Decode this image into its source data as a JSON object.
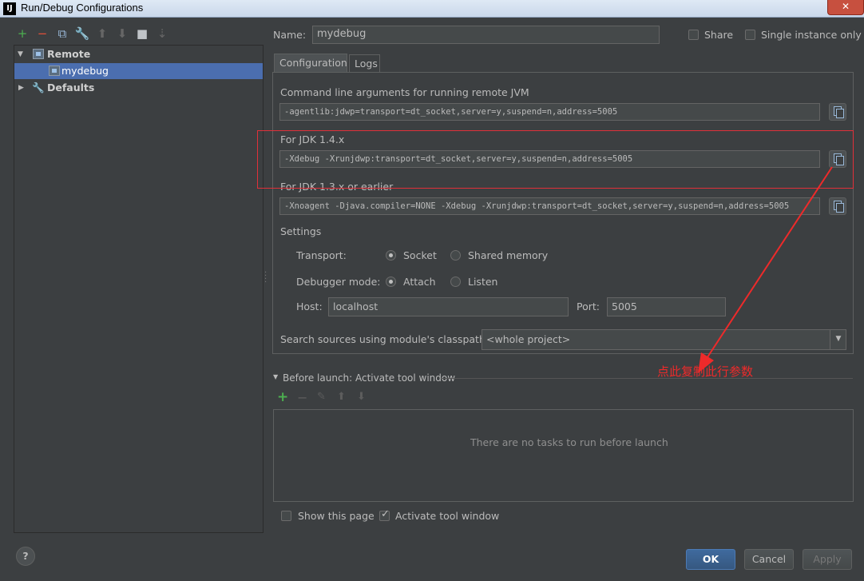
{
  "window": {
    "icon_text": "IJ",
    "title": "Run/Debug Configurations",
    "close_symbol": "✕"
  },
  "left_toolbar": {
    "icons": [
      {
        "name": "add-icon",
        "glyph": "+",
        "color": "#4caf50"
      },
      {
        "name": "remove-icon",
        "glyph": "−",
        "color": "#e0503a"
      },
      {
        "name": "copy-config-icon",
        "glyph": "⧉",
        "color": "#9ab9d9"
      },
      {
        "name": "edit-defaults-icon",
        "glyph": "🔧",
        "color": "#d7a84a"
      },
      {
        "name": "move-up-icon",
        "glyph": "⬆",
        "color": "#666666"
      },
      {
        "name": "move-down-icon",
        "glyph": "⬇",
        "color": "#666666"
      },
      {
        "name": "folder-icon",
        "glyph": "■",
        "color": "#c0c4c8"
      },
      {
        "name": "sort-icon",
        "glyph": "⇣",
        "color": "#666666"
      }
    ]
  },
  "tree": {
    "remote_label": "Remote",
    "mydebug_label": "mydebug",
    "defaults_label": "Defaults"
  },
  "form": {
    "name_label": "Name:",
    "name_value": "mydebug",
    "share_label": "Share",
    "single_instance_label": "Single instance only",
    "tabs": [
      "Configuration",
      "Logs"
    ],
    "cmd_label": "Command line arguments for running remote JVM",
    "cmd_value": "-agentlib:jdwp=transport=dt_socket,server=y,suspend=n,address=5005",
    "jdk14_label": "For JDK 1.4.x",
    "jdk14_value": "-Xdebug -Xrunjdwp:transport=dt_socket,server=y,suspend=n,address=5005",
    "jdk13_label": "For JDK 1.3.x or earlier",
    "jdk13_value": "-Xnoagent -Djava.compiler=NONE -Xdebug -Xrunjdwp:transport=dt_socket,server=y,suspend=n,address=5005",
    "settings_label": "Settings",
    "transport_label": "Transport:",
    "socket_label": "Socket",
    "shared_memory_label": "Shared memory",
    "debugger_mode_label": "Debugger mode:",
    "attach_label": "Attach",
    "listen_label": "Listen",
    "host_label": "Host:",
    "host_value": "localhost",
    "port_label": "Port:",
    "port_value": "5005",
    "search_sources_label": "Search sources using module's classpath:",
    "search_sources_value": "<whole project>"
  },
  "annotation": {
    "text": "点此复制此行参数",
    "color": "#ee2a2a"
  },
  "before_launch": {
    "title": "Before launch: Activate tool window",
    "empty_text": "There are no tasks to run before launch",
    "show_page_label": "Show this page",
    "activate_label": "Activate tool window"
  },
  "buttons": {
    "help": "?",
    "ok": "OK",
    "cancel": "Cancel",
    "apply": "Apply"
  }
}
